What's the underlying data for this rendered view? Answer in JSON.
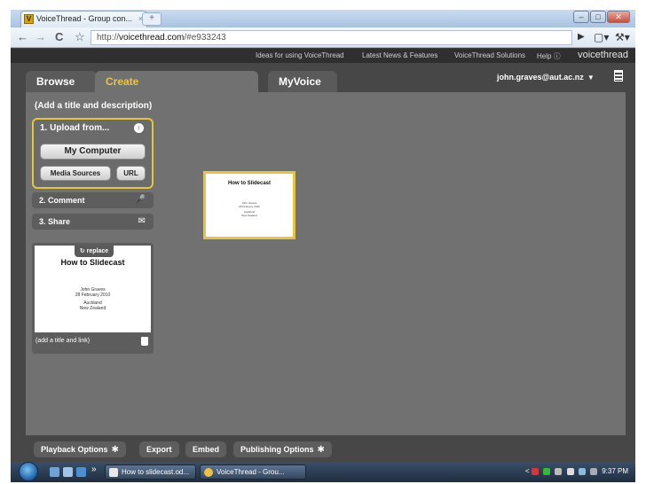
{
  "browser": {
    "tab_title": "VoiceThread - Group con...",
    "tab_close": "×",
    "tab_favicon": "V",
    "new_tab": "+",
    "url_prefix": "http://",
    "url_host": "voicethread.com",
    "url_path": "/#e933243",
    "back_icon": "←",
    "forward_icon": "→",
    "reload_icon": "C",
    "star_icon": "☆",
    "play_icon": "▶",
    "page_icon": "▢▾",
    "wrench_icon": "⚒▾",
    "min_icon": "–",
    "max_icon": "□",
    "close_icon": "✕"
  },
  "vt_nav": {
    "ideas": "Ideas for using VoiceThread",
    "news": "Latest News & Features",
    "solutions": "VoiceThread Solutions",
    "help": "Help ⓘ",
    "brand": "voicethread"
  },
  "main_tabs": {
    "browse": "Browse",
    "create": "Create",
    "myvoice": "MyVoice"
  },
  "user": {
    "email": "john.graves@aut.ac.nz",
    "caret": "▼"
  },
  "create_panel": {
    "title_placeholder": "(Add a title and description)",
    "upload_heading": "1. Upload from...",
    "upload_icon": "↑",
    "my_computer": "My Computer",
    "media_sources": "Media Sources",
    "url": "URL",
    "comment": "2. Comment",
    "comment_icon": "🎤",
    "share": "3. Share",
    "share_icon": "✉"
  },
  "slide": {
    "replace": "replace",
    "replace_icon": "↻",
    "title": "How to Slidecast",
    "author": "John Graves",
    "date": "28 February 2010",
    "place1": "Auckland",
    "place2": "New Zealand",
    "caption": "(add a title and link)"
  },
  "bottom_bar": {
    "playback": "Playback Options",
    "export": "Export",
    "embed": "Embed",
    "publishing": "Publishing Options",
    "gear": "✱"
  },
  "taskbar": {
    "task1": "How to slidecast.od...",
    "task2": "VoiceThread - Grou...",
    "chevron": "»",
    "clock": "9:37 PM",
    "tray_arrow": "<"
  },
  "colors": {
    "accent_yellow": "#e5c43e",
    "panel_gray": "#717171",
    "dark_bg": "#474747"
  }
}
